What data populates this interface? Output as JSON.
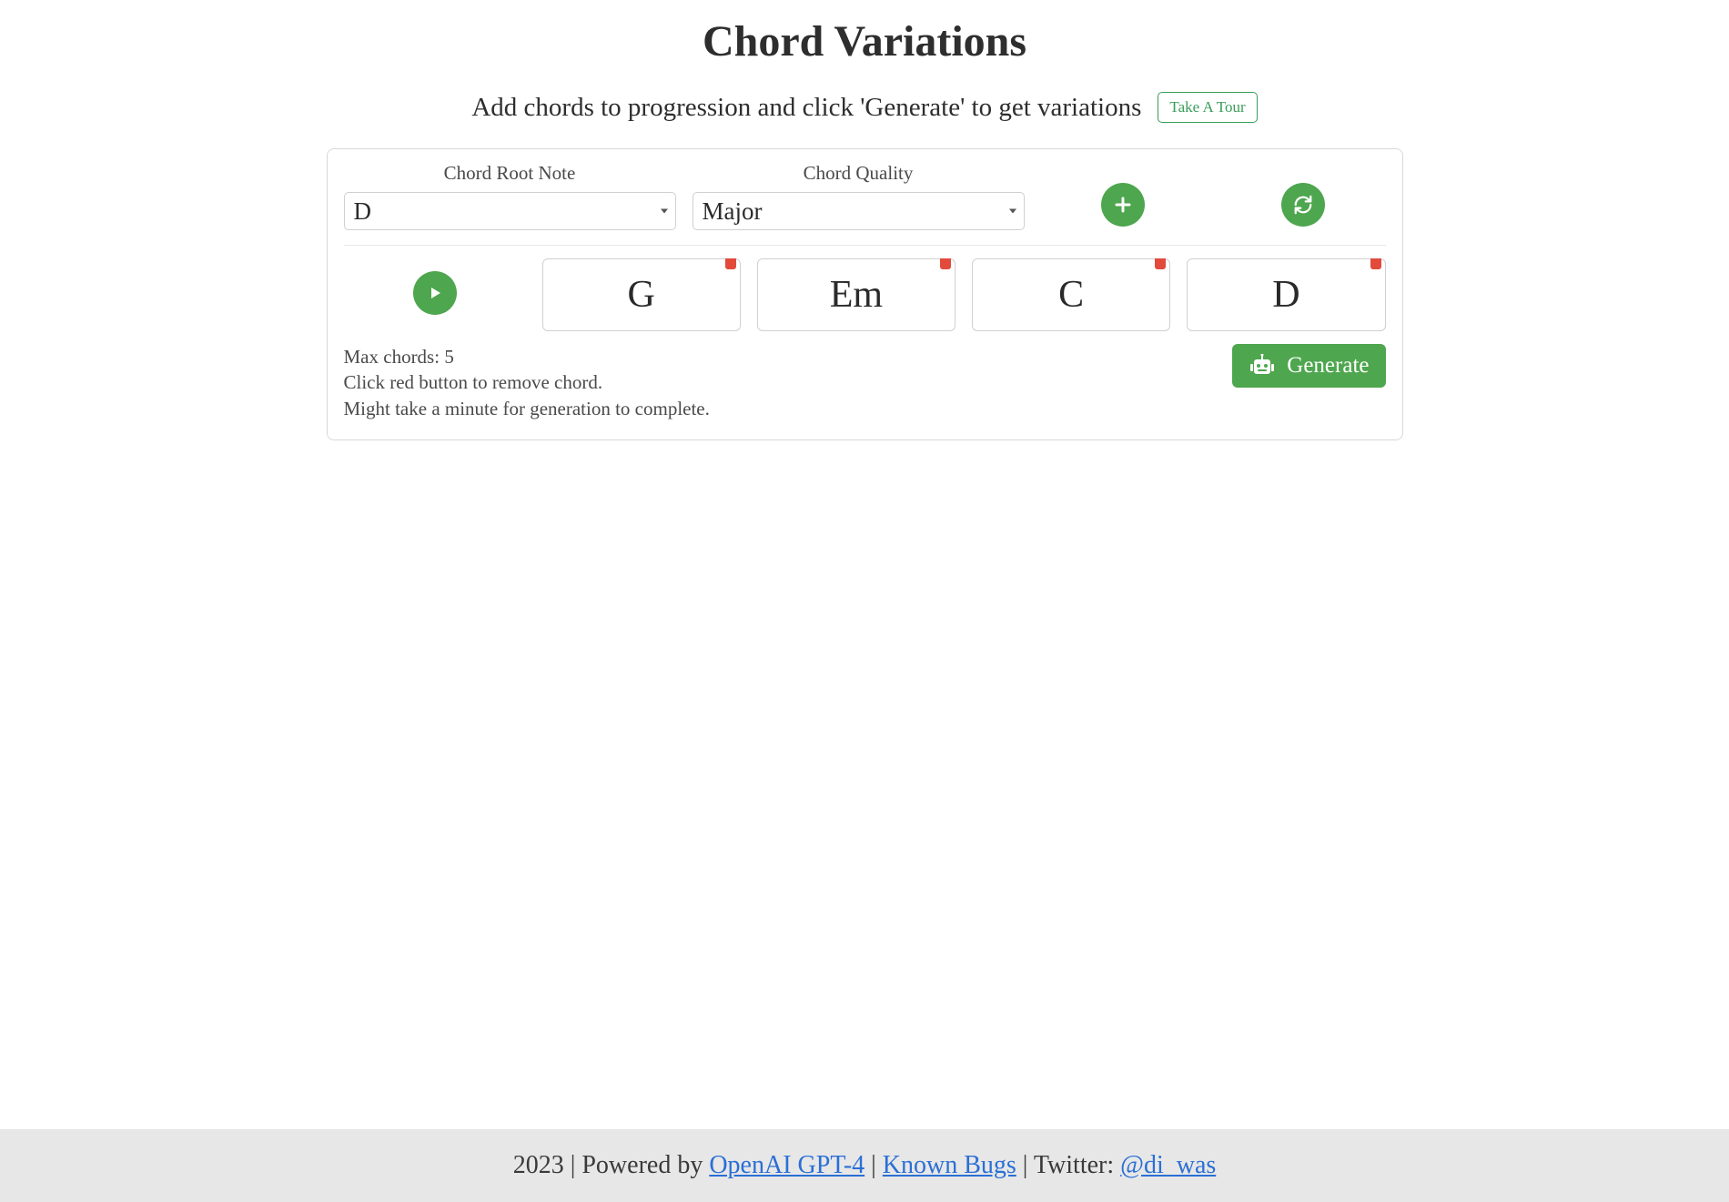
{
  "header": {
    "title": "Chord Variations",
    "subtitle": "Add chords to progression and click 'Generate' to get variations",
    "tour_label": "Take A Tour"
  },
  "controls": {
    "root_label": "Chord Root Note",
    "root_value": "D",
    "quality_label": "Chord Quality",
    "quality_value": "Major"
  },
  "progression": {
    "chords": [
      "G",
      "Em",
      "C",
      "D"
    ]
  },
  "info": {
    "max_chords": "Max chords: 5",
    "remove_hint": "Click red button to remove chord.",
    "wait_hint": "Might take a minute for generation to complete."
  },
  "actions": {
    "generate_label": "Generate"
  },
  "footer": {
    "year": "2023",
    "powered_by_prefix": "Powered by",
    "openai_label": "OpenAI GPT-4",
    "bugs_label": "Known Bugs",
    "twitter_prefix": "Twitter:",
    "twitter_handle": "@di_was"
  }
}
